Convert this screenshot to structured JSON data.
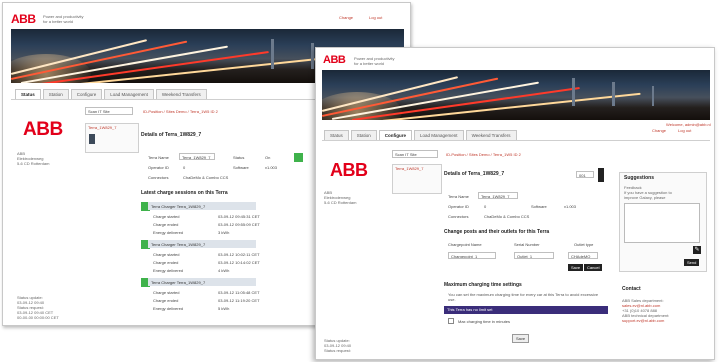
{
  "brand": {
    "logo": "ABB",
    "tagline_lines": [
      "Power and productivity",
      "for a better world"
    ]
  },
  "header_links": {
    "change": "Change",
    "logout": "Log out"
  },
  "tabs": [
    "Status",
    "Station",
    "Configure",
    "Load Management",
    "Weekend Transfers"
  ],
  "back_window": {
    "active_tab": "Status",
    "site_select": "Scan IT Site",
    "breadcrumb": "ID-Position / Sites Demo / Terra_1W5 ID 2",
    "selected_item": "Terra_1W829_7",
    "address_lines": [
      "ABB",
      "Elektrodenweg",
      "5-6 CD Rotterdam"
    ],
    "details_title": "Details of Terra_1W829_7",
    "details": {
      "rows": [
        {
          "k1": "Terra Name",
          "v1": "Terra_1W829_7",
          "k2": "Status",
          "v2": "On"
        },
        {
          "k1": "Operator ID",
          "v1": "0",
          "k2": "Software",
          "v2": "v1.003"
        },
        {
          "k1": "Connectors",
          "v1": "ChaDeMo & Combo CCS"
        }
      ]
    },
    "sessions_title": "Latest charge sessions on this Terra",
    "sessions": [
      {
        "title": "Terra Charger Terra_1W829_7",
        "rows": [
          [
            "Charge started",
            "03-09-12 09:45:31 CET"
          ],
          [
            "Charge ended",
            "03-09-12 09:55:09 CET"
          ],
          [
            "Energy delivered",
            "3 kWh"
          ]
        ]
      },
      {
        "title": "Terra Charger Terra_1W829_7",
        "rows": [
          [
            "Charge started",
            "03-09-12 10:02:11 CET"
          ],
          [
            "Charge ended",
            "03-09-12 10:14:02 CET"
          ],
          [
            "Energy delivered",
            "4 kWh"
          ]
        ]
      },
      {
        "title": "Terra Charger Terra_1W829_7",
        "rows": [
          [
            "Charge started",
            "03-09-12 11:05:48 CET"
          ],
          [
            "Charge ended",
            "03-09-12 11:19:20 CET"
          ],
          [
            "Energy delivered",
            "5 kWh"
          ]
        ]
      }
    ],
    "footer_lines": [
      "Status update:",
      "03-09-12 09:40",
      "Status request:",
      "03-09-12 09:40 CET",
      "00-00-00 00:00:00 CET"
    ]
  },
  "front_window": {
    "active_tab": "Configure",
    "site_select": "Scan IT Site",
    "breadcrumb": "ID-Position / Sites Demo / Terra_1W5 ID 2",
    "selected_item": "Terra_1W829_7",
    "address_lines": [
      "ABB",
      "Elektrodenweg",
      "5-6 CD Rotterdam"
    ],
    "header_meta": "Welcome, admin@abb.nl",
    "details_title": "Details of Terra_1W829_7",
    "details_value": "001",
    "details": {
      "rows": [
        {
          "k1": "Terra Name",
          "v1": "Terra_1W829_7"
        },
        {
          "k1": "Operator ID",
          "v1": "0",
          "k2": "Software",
          "v2": "v1.003"
        },
        {
          "k1": "Connectors",
          "v1": "ChaDeMo & Combo CCS"
        }
      ]
    },
    "change_title": "Change posts and their outlets for this Terra",
    "change_headers": [
      "Chargepoint Name",
      "Serial Number",
      "Outlet type"
    ],
    "change_values": [
      "Chargepoint_1",
      "Outlet_1",
      "CHAdeMO"
    ],
    "save_label": "Save",
    "cancel_label": "Cancel",
    "max_title": "Maximum charging time settings",
    "max_desc": "You can set the maximum charging time for every car at this Terra to avoid excessive use.",
    "max_bar": "This Terra has no limit set",
    "max_checkbox": "Max charging time in minutes",
    "max_button": "Save",
    "suggestions_title": "Suggestions",
    "suggestions_text": [
      "Feedback",
      "If you have a suggestion to",
      "improve Galaxy, please"
    ],
    "send_label": "Send",
    "contact_title": "Contact",
    "contact_lines": [
      "ABB Sales department:",
      "sales.ev@nl.abb.com",
      "+31 (0)10 4078 888",
      "ABB technical department:",
      "support.ev@nl.abb.com"
    ],
    "footer_lines": [
      "Status update:",
      "03-09-12 09:40",
      "Status request:"
    ]
  },
  "colors": {
    "abb_red": "#e2001a",
    "session_green": "#3fb24b",
    "bar_purple": "#3a2d7a"
  }
}
